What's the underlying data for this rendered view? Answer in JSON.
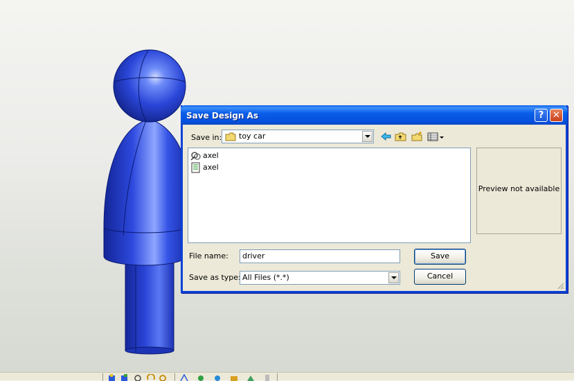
{
  "viewport": {
    "model_name": "driver"
  },
  "dialog": {
    "title": "Save Design As",
    "help_label": "?",
    "close_label": "✕",
    "save_in_label": "Save in:",
    "save_in_value": "toy car",
    "files": [
      {
        "name": "axel",
        "icon": "assembly-icon"
      },
      {
        "name": "axel",
        "icon": "part-document-icon"
      }
    ],
    "preview_text": "Preview not available",
    "file_name_label": "File name:",
    "file_name_value": "driver",
    "save_as_type_label": "Save as type:",
    "save_as_type_value": "All Files (*.*)",
    "save_button": "Save",
    "cancel_button": "Cancel"
  },
  "colors": {
    "titlebar": "#0a5ee8",
    "model_blue": "#2040d8",
    "dialog_face": "#ece9d8"
  }
}
